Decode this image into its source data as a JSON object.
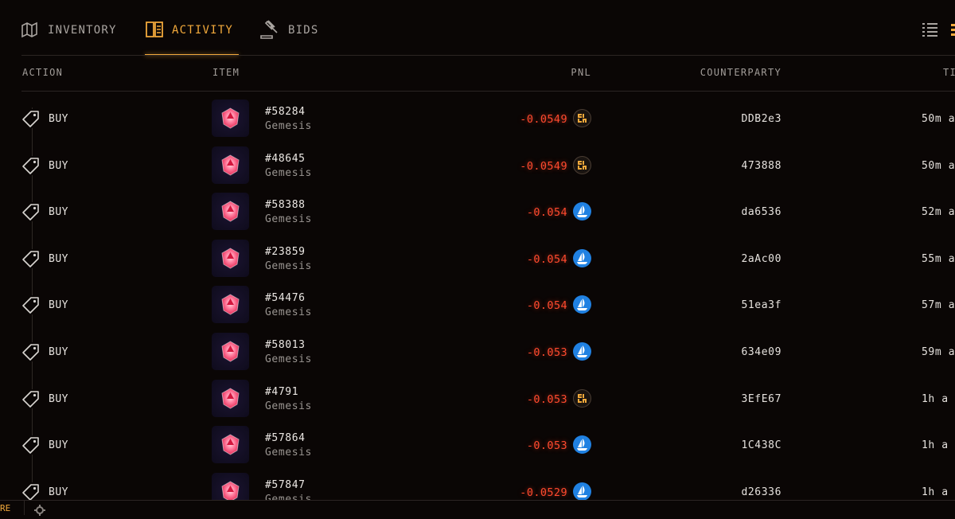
{
  "tabs": [
    {
      "label": "INVENTORY",
      "icon": "map-icon",
      "active": false
    },
    {
      "label": "ACTIVITY",
      "icon": "book-icon",
      "active": true
    },
    {
      "label": "BIDS",
      "icon": "gavel-icon",
      "active": false
    }
  ],
  "columns": {
    "action": "ACTION",
    "item": "ITEM",
    "pnl": "PNL",
    "counterparty": "COUNTERPARTY",
    "time": "TI"
  },
  "rows": [
    {
      "action": "BUY",
      "item_id": "#58284",
      "collection": "Gemesis",
      "pnl": "-0.0549",
      "marketplace": "blur-icon",
      "counterparty": "DDB2e3",
      "time": "50m a"
    },
    {
      "action": "BUY",
      "item_id": "#48645",
      "collection": "Gemesis",
      "pnl": "-0.0549",
      "marketplace": "blur-icon",
      "counterparty": "473888",
      "time": "50m a"
    },
    {
      "action": "BUY",
      "item_id": "#58388",
      "collection": "Gemesis",
      "pnl": "-0.054",
      "marketplace": "opensea-icon",
      "counterparty": "da6536",
      "time": "52m a"
    },
    {
      "action": "BUY",
      "item_id": "#23859",
      "collection": "Gemesis",
      "pnl": "-0.054",
      "marketplace": "opensea-icon",
      "counterparty": "2aAc00",
      "time": "55m a"
    },
    {
      "action": "BUY",
      "item_id": "#54476",
      "collection": "Gemesis",
      "pnl": "-0.054",
      "marketplace": "opensea-icon",
      "counterparty": "51ea3f",
      "time": "57m a"
    },
    {
      "action": "BUY",
      "item_id": "#58013",
      "collection": "Gemesis",
      "pnl": "-0.053",
      "marketplace": "opensea-icon",
      "counterparty": "634e09",
      "time": "59m a"
    },
    {
      "action": "BUY",
      "item_id": "#4791",
      "collection": "Gemesis",
      "pnl": "-0.053",
      "marketplace": "blur-icon",
      "counterparty": "3EfE67",
      "time": "1h a"
    },
    {
      "action": "BUY",
      "item_id": "#57864",
      "collection": "Gemesis",
      "pnl": "-0.053",
      "marketplace": "opensea-icon",
      "counterparty": "1C438C",
      "time": "1h a"
    },
    {
      "action": "BUY",
      "item_id": "#57847",
      "collection": "Gemesis",
      "pnl": "-0.0529",
      "marketplace": "opensea-icon",
      "counterparty": "d26336",
      "time": "1h a"
    }
  ],
  "bottom_bar": {
    "fragment": "RE",
    "icon": "gear-icon"
  },
  "colors": {
    "accent": "#f2a93b",
    "negative": "#ff4a2e",
    "opensea": "#2081e2",
    "background": "#0a0605"
  }
}
